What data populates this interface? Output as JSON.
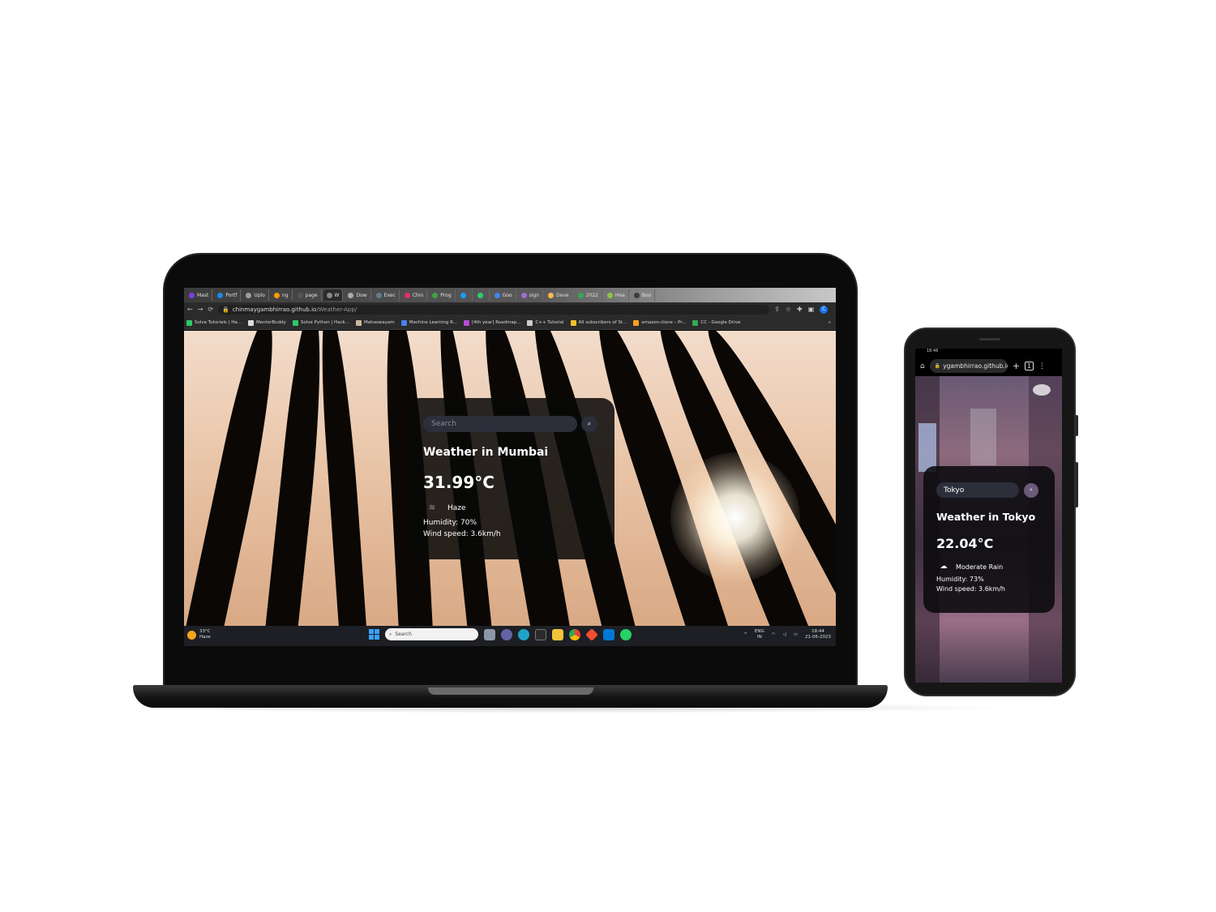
{
  "laptop": {
    "tabs": [
      {
        "label": "Mast",
        "color": "#7b3fe4"
      },
      {
        "label": "Portf",
        "color": "#1e88e5"
      },
      {
        "label": "Uplo",
        "color": "#9e9e9e"
      },
      {
        "label": "ng",
        "color": "#ff9800"
      },
      {
        "label": "page",
        "color": "#555555"
      },
      {
        "label": "W",
        "color": "#888888"
      },
      {
        "label": "Dow",
        "color": "#aaaaaa"
      },
      {
        "label": "Exec",
        "color": "#607d8b"
      },
      {
        "label": "Chin",
        "color": "#e1306c"
      },
      {
        "label": "Prog",
        "color": "#43a047"
      },
      {
        "label": "",
        "color": "#1d9bf0"
      },
      {
        "label": "",
        "color": "#2ecc71"
      },
      {
        "label": "Goo",
        "color": "#4285f4"
      },
      {
        "label": "sign",
        "color": "#a06cd5"
      },
      {
        "label": "Deve",
        "color": "#ffb74d"
      },
      {
        "label": "2022",
        "color": "#34a853"
      },
      {
        "label": "Hea",
        "color": "#8bc34a"
      },
      {
        "label": "Boo",
        "color": "#3c3c3c"
      }
    ],
    "address": {
      "host": "chinmaygambhirrao.github.io",
      "path": "/Weather-App/"
    },
    "profile_initial": "C",
    "bookmarks": [
      {
        "label": "Solve Tutorials | Ha...",
        "color": "#2ec866"
      },
      {
        "label": "MentorBuddy",
        "color": "#dddddd"
      },
      {
        "label": "Solve Python | Hack...",
        "color": "#2ec866"
      },
      {
        "label": "Mahaswayam",
        "color": "#c9b79c"
      },
      {
        "label": "Machine Learning R...",
        "color": "#4a7ff0"
      },
      {
        "label": "[4th year] Roadmap...",
        "color": "#b44bd8"
      },
      {
        "label": "C++ Tutorial",
        "color": "#cccccc"
      },
      {
        "label": "All subscribers of St...",
        "color": "#f2c12e"
      },
      {
        "label": "amazon-clone – Pr...",
        "color": "#ff9f1c"
      },
      {
        "label": "CC - Google Drive",
        "color": "#34a853"
      }
    ],
    "bookmarks_more": "»",
    "weather": {
      "search_placeholder": "Search",
      "city_label": "Weather in Mumbai",
      "temperature": "31.99°C",
      "description": "Haze",
      "humidity": "Humidity: 70%",
      "wind": "Wind speed: 3.6km/h"
    },
    "taskbar": {
      "weather_temp": "33°C",
      "weather_desc": "Haze",
      "search_placeholder": "Search",
      "lang_top": "ENG",
      "lang_bottom": "IN",
      "time": "18:44",
      "date": "21-06-2023"
    }
  },
  "phone": {
    "status_time": "18:46",
    "address_host": "ygambhirrao.github.io",
    "weather": {
      "search_value": "Tokyo",
      "city_label": "Weather in Tokyo",
      "temperature": "22.04°C",
      "description": "Moderate Rain",
      "humidity": "Humidity: 73%",
      "wind": "Wind speed: 3.6km/h"
    }
  },
  "colors": {
    "card_bg": "#0b0b0b",
    "search_bg": "#2c2f3a",
    "phone_search_button": "#6b5a7a",
    "windows_accent": "#3aa0ff"
  }
}
